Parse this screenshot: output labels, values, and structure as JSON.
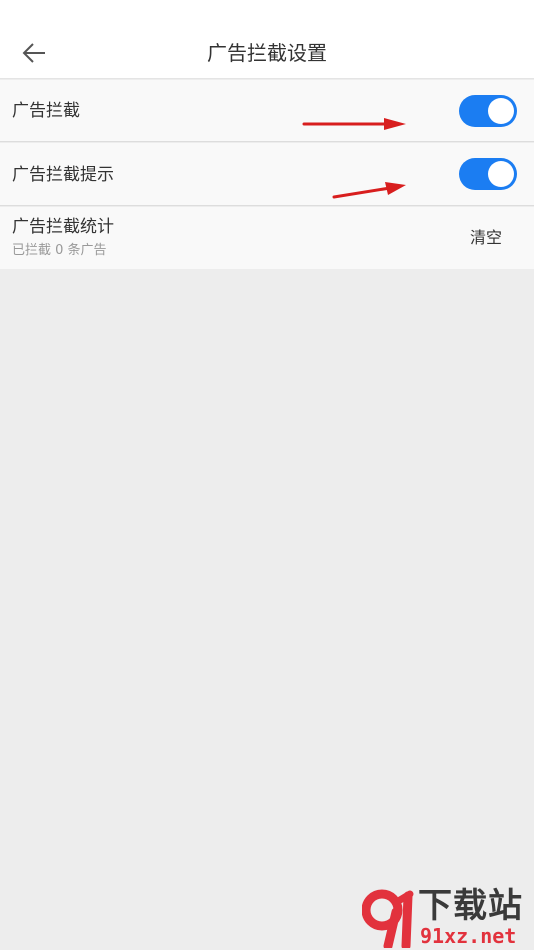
{
  "header": {
    "title": "广告拦截设置"
  },
  "settings": {
    "ad_block": {
      "label": "广告拦截",
      "enabled": true
    },
    "ad_block_tip": {
      "label": "广告拦截提示",
      "enabled": true
    },
    "ad_block_stats": {
      "label": "广告拦截统计",
      "subtitle": "已拦截 0 条广告",
      "action_label": "清空"
    }
  },
  "annotations": {
    "arrow_color": "#d81e1e"
  },
  "watermark": {
    "top_text": "下载站",
    "bottom_text": "91xz.net"
  },
  "colors": {
    "accent": "#1b7df2",
    "background": "#ededed"
  }
}
